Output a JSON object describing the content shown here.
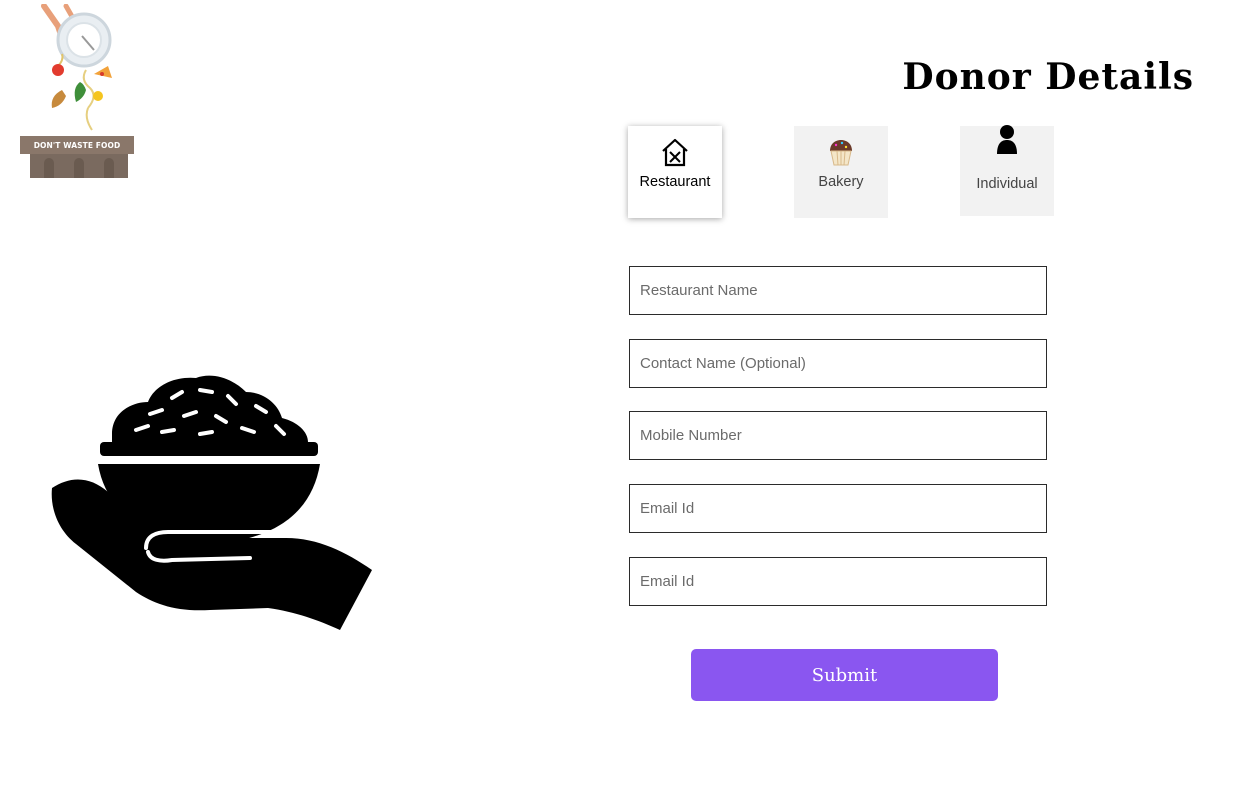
{
  "logo": {
    "badge_text": "DON'T WASTE FOOD"
  },
  "header": {
    "title": "Donor Details"
  },
  "donor_types": [
    {
      "label": "Restaurant",
      "icon": "restaurant-icon",
      "active": true
    },
    {
      "label": "Bakery",
      "icon": "cupcake-icon",
      "active": false
    },
    {
      "label": "Individual",
      "icon": "person-icon",
      "active": false
    }
  ],
  "form": {
    "restaurant_name_placeholder": "Restaurant Name",
    "contact_name_placeholder": "Contact Name (Optional)",
    "mobile_placeholder": "Mobile Number",
    "email_placeholder": "Email Id",
    "email2_placeholder": "Email Id",
    "submit_label": "Submit"
  },
  "colors": {
    "accent": "#8a56f0",
    "card_bg": "#f2f2f2"
  }
}
